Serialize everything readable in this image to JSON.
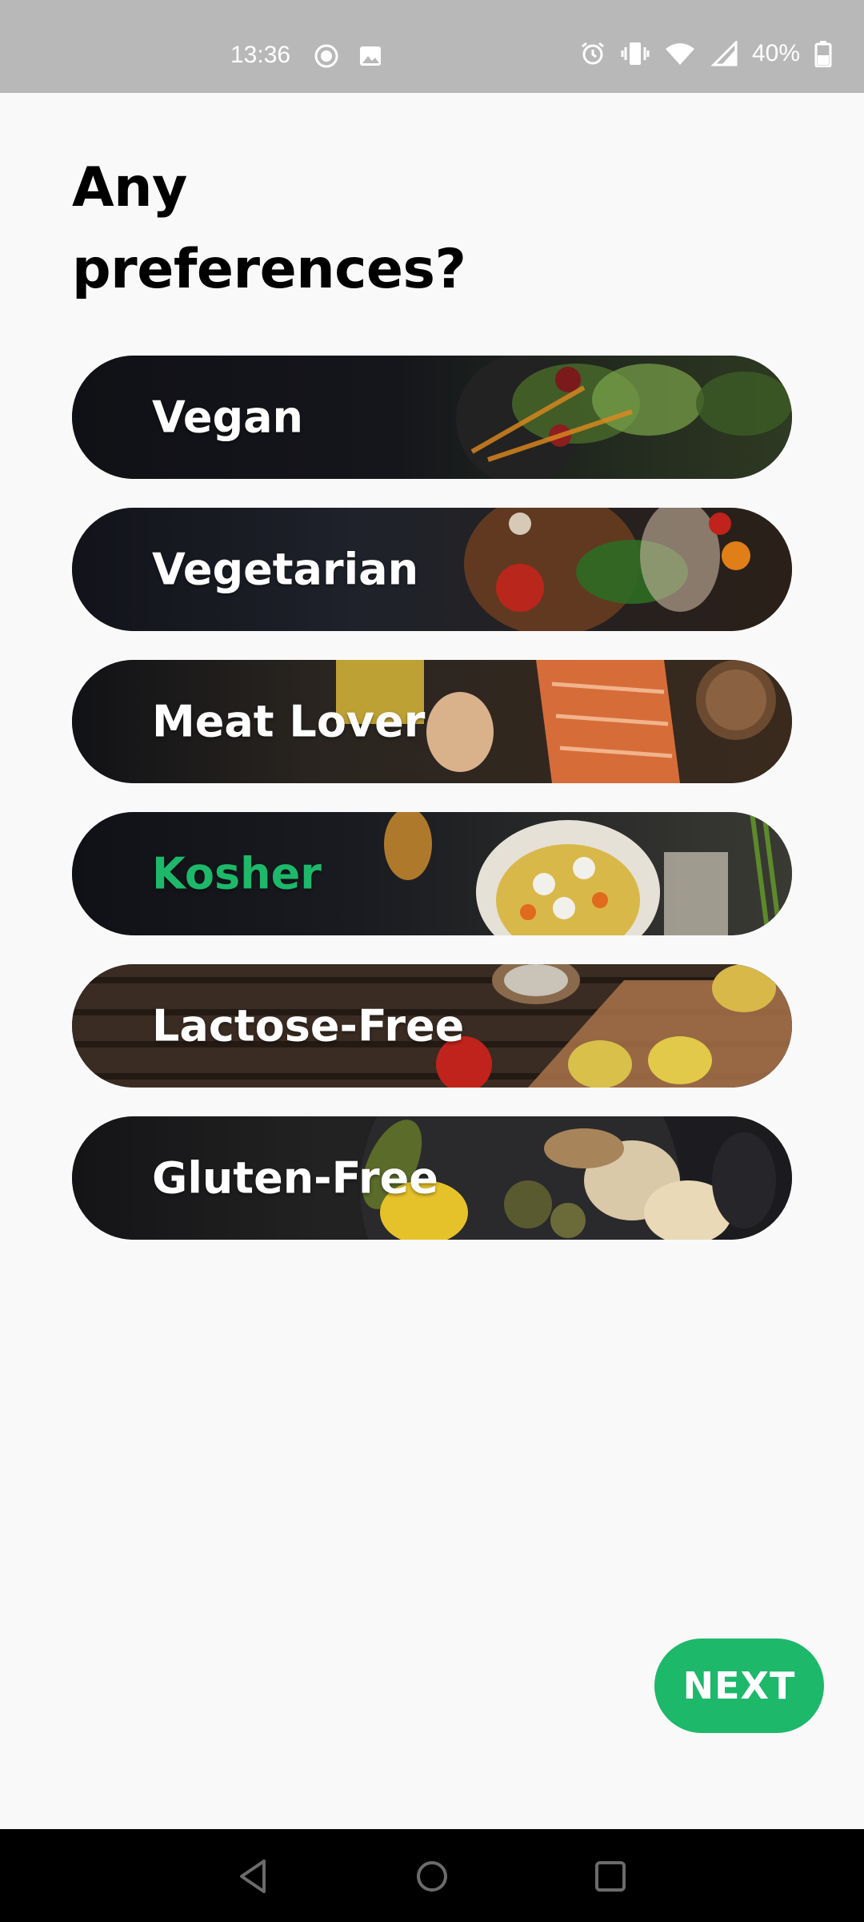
{
  "status_bar": {
    "time": "13:36",
    "battery": "40%",
    "icons_left": [
      "record-icon",
      "image-icon"
    ],
    "icons_right": [
      "alarm-icon",
      "vibrate-icon",
      "wifi-icon",
      "signal-icon",
      "battery-icon"
    ]
  },
  "title": {
    "line1": "Any",
    "line2": "preferences?"
  },
  "preferences": [
    {
      "label": "Vegan",
      "selected": false
    },
    {
      "label": "Vegetarian",
      "selected": false
    },
    {
      "label": "Meat Lover",
      "selected": false
    },
    {
      "label": "Kosher",
      "selected": true
    },
    {
      "label": "Lactose-Free",
      "selected": false
    },
    {
      "label": "Gluten-Free",
      "selected": false
    }
  ],
  "next_button": {
    "label": "NEXT"
  },
  "colors": {
    "accent": "#1db86a",
    "pill_dark": "#16171d",
    "background": "#f9f9f9",
    "status_bar": "#b8b8b8"
  },
  "nav_bar": {
    "buttons": [
      "back-icon",
      "home-icon",
      "recents-icon"
    ]
  }
}
